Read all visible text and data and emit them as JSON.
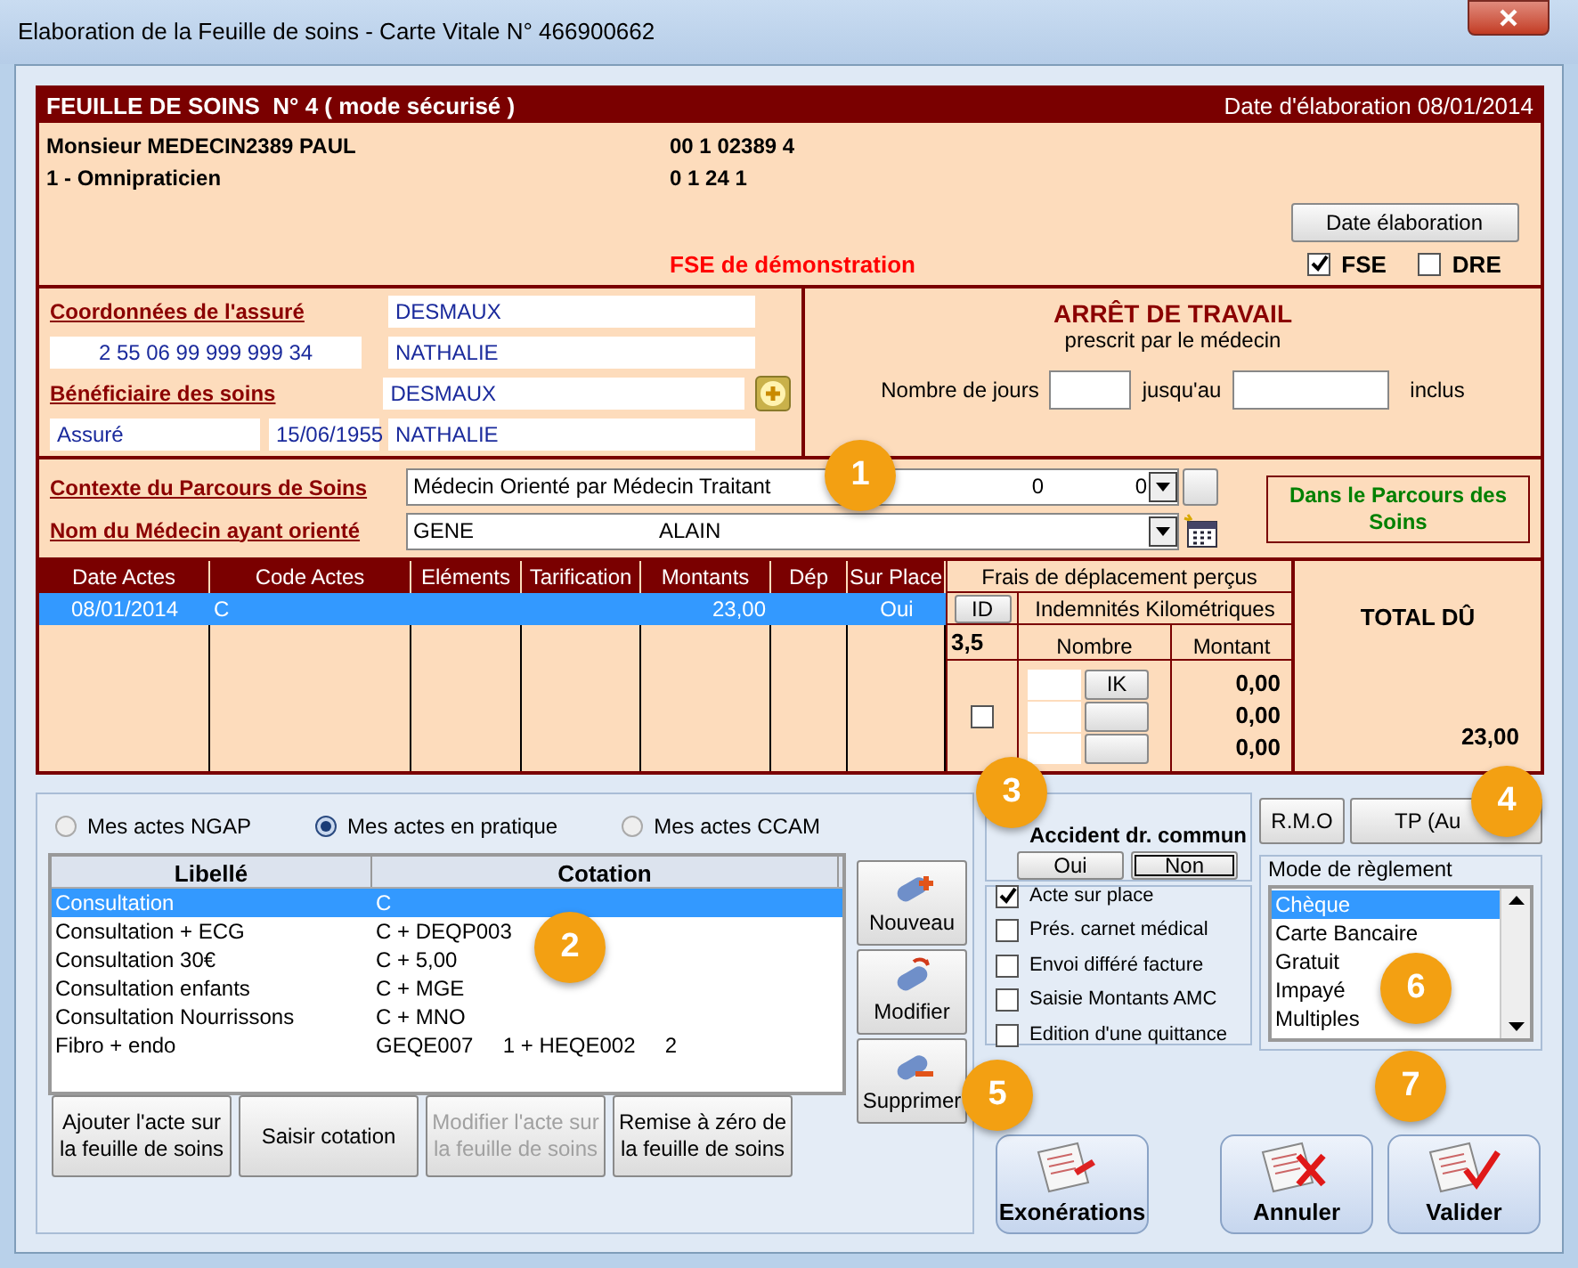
{
  "window": {
    "title": "Elaboration de la Feuille de soins - Carte Vitale N° 466900662"
  },
  "sheet": {
    "title": "FEUILLE DE SOINS  N° 4 ( mode sécurisé )",
    "date": "Date d'élaboration 08/01/2014"
  },
  "doctor": {
    "name": "Monsieur MEDECIN2389 PAUL",
    "specialty": "1 - Omnipraticien",
    "number_1": "00 1 02389 4",
    "number_2": "0 1 24 1",
    "demo": "FSE de démonstration",
    "date_button": "Date élaboration",
    "options": [
      {
        "label": "FSE",
        "checked": true
      },
      {
        "label": "DRE",
        "checked": false
      }
    ]
  },
  "insured": {
    "label": "Coordonnées de l'assuré",
    "nir": "2 55 06 99 999 999 34",
    "last_name": "DESMAUX",
    "first_name": "NATHALIE"
  },
  "beneficiary": {
    "label": "Bénéficiaire des soins",
    "quality": "Assuré",
    "birth_date": "15/06/1955",
    "last_name": "DESMAUX",
    "first_name": "NATHALIE"
  },
  "work_stop": {
    "title": "ARRÊT DE TRAVAIL",
    "subtitle": "prescrit par le médecin",
    "days_label": "Nombre de jours",
    "until_label": "jusqu'au",
    "inclusive_label": "inclus"
  },
  "care_path": {
    "context_label": "Contexte du Parcours de Soins",
    "context_value": "Médecin Orienté par Médecin Traitant",
    "context_n1": "0",
    "context_n2": "0",
    "doctor_label": "Nom du Médecin ayant orienté",
    "doctor_last": "GENE",
    "doctor_first": "ALAIN",
    "status": "Dans le Parcours des Soins"
  },
  "acts_table": {
    "columns": [
      "Date Actes",
      "Code Actes",
      "Eléments",
      "Tarification",
      "Montants",
      "Dép",
      "Sur Place"
    ],
    "rows": [
      {
        "date": "08/01/2014",
        "code": "C",
        "amount": "23,00",
        "on_site": "Oui",
        "selected": true
      }
    ]
  },
  "travel_fees": {
    "title": "Frais de déplacement perçus",
    "id_button": "ID",
    "ik_title": "Indemnités Kilométriques",
    "id_value": "3,5",
    "count_label": "Nombre",
    "amount_label": "Montant",
    "ik_button": "IK",
    "checked": false,
    "amounts": [
      "0,00",
      "0,00",
      "0,00"
    ]
  },
  "total": {
    "label": "TOTAL DÛ",
    "value": "23,00"
  },
  "act_sources": [
    {
      "label": "Mes actes NGAP",
      "selected": false
    },
    {
      "label": "Mes actes en pratique",
      "selected": true
    },
    {
      "label": "Mes actes CCAM",
      "selected": false
    }
  ],
  "act_list": {
    "columns": [
      "Libellé",
      "Cotation"
    ],
    "rows": [
      {
        "label": "Consultation",
        "cotation": "C",
        "selected": true
      },
      {
        "label": "Consultation + ECG",
        "cotation": "C + DEQP003",
        "selected": false
      },
      {
        "label": "Consultation 30€",
        "cotation": "C + 5,00",
        "selected": false
      },
      {
        "label": "Consultation enfants",
        "cotation": "C + MGE",
        "selected": false
      },
      {
        "label": "Consultation Nourrissons",
        "cotation": "C + MNO",
        "selected": false
      },
      {
        "label": "Fibro + endo",
        "cotation": "GEQE007     1 + HEQE002     2",
        "selected": false
      }
    ]
  },
  "list_buttons": [
    {
      "label": "Nouveau",
      "kind": "add"
    },
    {
      "label": "Modifier",
      "kind": "edit"
    },
    {
      "label": "Supprimer",
      "kind": "delete"
    }
  ],
  "sheet_buttons": [
    {
      "label": "Ajouter l'acte sur la feuille de soins",
      "disabled": false
    },
    {
      "label": "Saisir cotation",
      "disabled": false
    },
    {
      "label": "Modifier l'acte sur la feuille de soins",
      "disabled": true
    },
    {
      "label": "Remise à zéro de la feuille de soins",
      "disabled": false
    }
  ],
  "accident": {
    "title": "Accident dr. commun",
    "options": [
      {
        "label": "Oui",
        "selected": false
      },
      {
        "label": "Non",
        "selected": true
      }
    ]
  },
  "flags": [
    {
      "label": "Acte sur place",
      "checked": true
    },
    {
      "label": "Prés. carnet médical",
      "checked": false
    },
    {
      "label": "Envoi différé facture",
      "checked": false
    },
    {
      "label": "Saisie Montants AMC",
      "checked": false
    },
    {
      "label": "Edition d'une quittance",
      "checked": false
    }
  ],
  "rmo_button": "R.M.O",
  "tp_button": "TP (Au",
  "payment": {
    "title": "Mode de règlement",
    "options": [
      {
        "label": "Chèque",
        "selected": true
      },
      {
        "label": "Carte Bancaire",
        "selected": false
      },
      {
        "label": "Gratuit",
        "selected": false
      },
      {
        "label": "Impayé",
        "selected": false
      },
      {
        "label": "Multiples",
        "selected": false
      }
    ]
  },
  "actions": [
    {
      "label": "Exonérations",
      "kind": "exemption"
    },
    {
      "label": "Annuler",
      "kind": "cancel"
    },
    {
      "label": "Valider",
      "kind": "validate"
    }
  ],
  "badges": [
    "1",
    "2",
    "3",
    "4",
    "5",
    "6",
    "7"
  ]
}
